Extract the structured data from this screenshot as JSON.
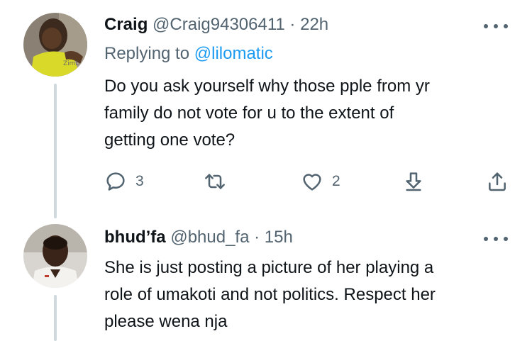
{
  "tweets": [
    {
      "name": "Craig",
      "handle": "@Craig94306411",
      "separator": "·",
      "time": "22h",
      "replying_prefix": "Replying to",
      "replying_to": "@lilomatic",
      "text": "Do you ask yourself why those pple from yr\nfamily do not vote for u to the extent of\ngetting one vote?",
      "avatar_watermark": "ZimL",
      "reply_count": "3",
      "retweet_count": "",
      "like_count": "2"
    },
    {
      "name": "bhud’fa",
      "handle": "@bhud_fa",
      "separator": "·",
      "time": "15h",
      "text": "She is just posting a picture of her playing a\nrole of umakoti and not politics. Respect her\nplease wena nja"
    }
  ],
  "icons": {
    "reply": "reply-icon",
    "retweet": "retweet-icon",
    "like": "heart-icon",
    "bookmark": "bookmark-download-icon",
    "share": "share-icon",
    "more": "more-options-icon"
  },
  "colors": {
    "text": "#0f1419",
    "secondary": "#536471",
    "link": "#1d9bf0",
    "thread_line": "#cfd9de"
  }
}
